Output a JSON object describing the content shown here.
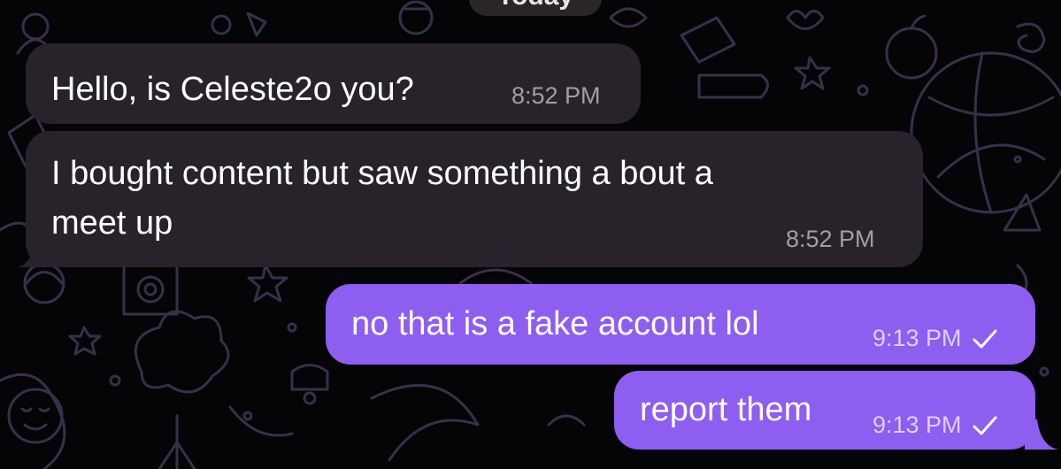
{
  "date_separator": "Today",
  "messages": [
    {
      "text": "Hello, is Celeste2o you?",
      "time": "8:52 PM"
    },
    {
      "line1": "I bought content but saw something a bout a",
      "line2": "meet up",
      "time": "8:52 PM"
    },
    {
      "text": "no that is a fake account lol",
      "time": "9:13 PM",
      "status_icon": "single-check-icon"
    },
    {
      "text": "report them",
      "time": "9:13 PM",
      "status_icon": "single-check-icon"
    }
  ],
  "colors": {
    "incoming_bubble": "#28232a",
    "outgoing_bubble": "#8d5ef0",
    "wallpaper_doodle": "#3a2f4a"
  }
}
